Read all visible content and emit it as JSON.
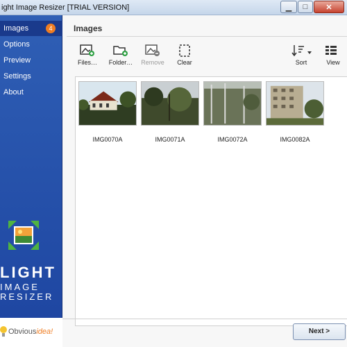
{
  "window": {
    "title": "ight Image Resizer  [TRIAL VERSION]"
  },
  "sidebar": {
    "items": [
      {
        "label": "Images",
        "badge": "4"
      },
      {
        "label": "Options"
      },
      {
        "label": "Preview"
      },
      {
        "label": "Settings"
      },
      {
        "label": "About"
      }
    ],
    "logo": {
      "line1": "LIGHT",
      "line2": "IMAGE",
      "line3": "RESIZER"
    },
    "brand": {
      "part1": "Obvious",
      "part2": "idea!"
    }
  },
  "main": {
    "title": "Images",
    "toolbar": {
      "files": "Files…",
      "folder": "Folder…",
      "remove": "Remove",
      "clear": "Clear",
      "sort": "Sort",
      "view": "View"
    },
    "images": [
      {
        "name": "IMG0070A"
      },
      {
        "name": "IMG0071A"
      },
      {
        "name": "IMG0072A"
      },
      {
        "name": "IMG0082A"
      }
    ],
    "next": "Next >"
  },
  "colors": {
    "sidebar": "#2552ad",
    "badge": "#ef7d22",
    "accent_green": "#2ea043"
  },
  "icons": [
    "image-add-icon",
    "folder-add-icon",
    "image-remove-icon",
    "clear-selection-icon",
    "sort-icon",
    "view-icon"
  ]
}
